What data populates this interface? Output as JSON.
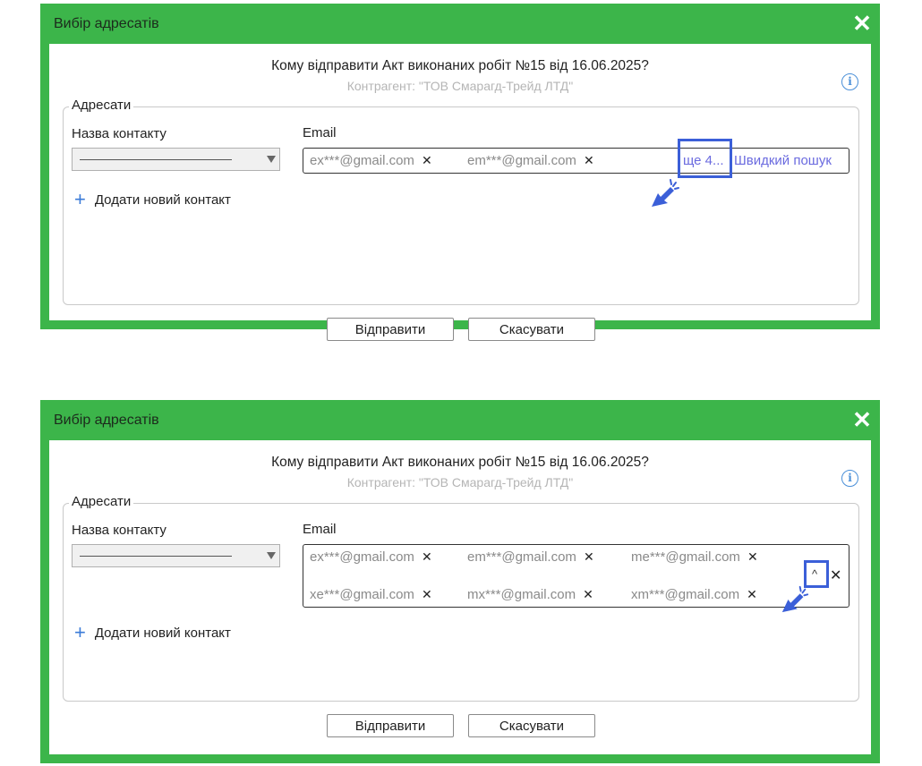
{
  "dialog": {
    "title": "Вибір адресатів",
    "close": "✕",
    "question": "Кому відправити Акт виконаних робіт №15 від 16.06.2025?",
    "counterparty": "Контрагент: \"ТОВ Смарагд-Трейд ЛТД\"",
    "info": "i",
    "recipients_legend": "Адресати",
    "contact_label": "Назва контакту",
    "email_label": "Email",
    "add_contact": "Додати новий контакт",
    "send": "Відправити",
    "cancel": "Скасувати"
  },
  "collapsed": {
    "emails": [
      "ex***@gmail.com",
      "em***@gmail.com"
    ],
    "more": "ще 4...",
    "quick_search": "Швидкий пошук"
  },
  "expanded": {
    "emails": [
      "ex***@gmail.com",
      "em***@gmail.com",
      "me***@gmail.com",
      "xe***@gmail.com",
      "mx***@gmail.com",
      "xm***@gmail.com"
    ],
    "collapse_icon": "^",
    "clear_icon": "✕"
  },
  "colors": {
    "accent_green": "#3cb54a",
    "link": "#6a6adf",
    "highlight": "#3b5fd8"
  }
}
